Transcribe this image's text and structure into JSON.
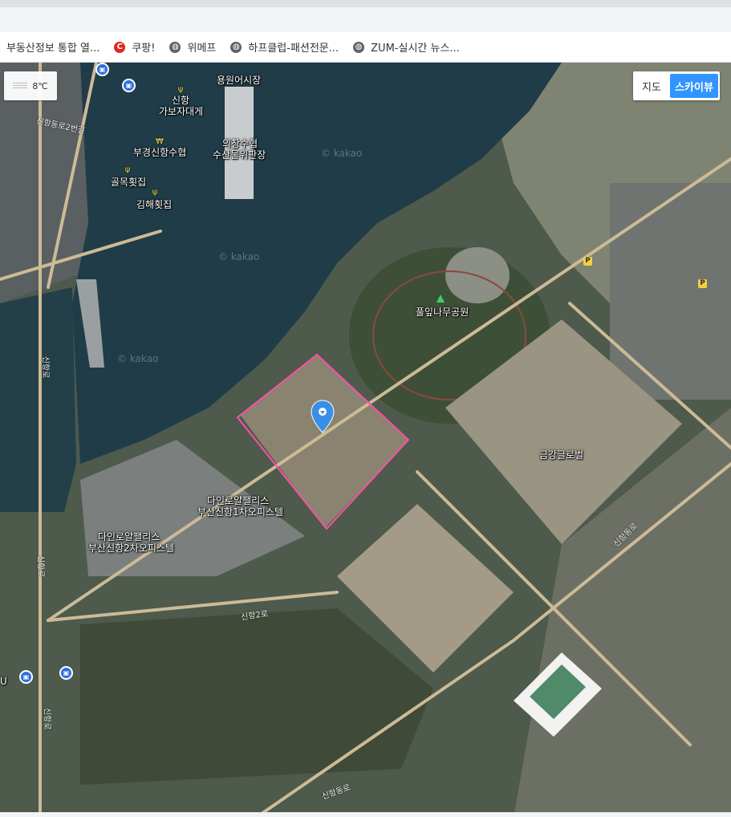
{
  "bookmarks": [
    {
      "label": "부동산정보 통합 열...",
      "icon": "none"
    },
    {
      "label": "쿠팡!",
      "icon": "coupang-icon"
    },
    {
      "label": "위메프",
      "icon": "globe-icon"
    },
    {
      "label": "하프클럽-패션전문...",
      "icon": "globe-icon"
    },
    {
      "label": "ZUM-실시간 뉴스...",
      "icon": "globe-icon"
    }
  ],
  "weather": {
    "temp": "8℃",
    "icon": "cloud-icon"
  },
  "map_type": {
    "map": "지도",
    "skyview": "스카이뷰",
    "active": "skyview",
    "active_color": "#3294ff"
  },
  "map": {
    "place_labels": {
      "fish_market": "용원어시장",
      "shinhang": "신항",
      "gabo": "가보자대게",
      "buggyeong": "부경신항수협",
      "golmok": "골목횟집",
      "gimhae": "김해횟집",
      "uichang_1": "의창수협",
      "uichang_2": "수산물위판장",
      "park": "풀잎나무공원",
      "geumgang": "금강글로벌",
      "daein1_1": "다인로얄팰리스",
      "daein1_2": "부산신항1차오피스텔",
      "daein2_1": "다인로얄팰리스",
      "daein2_2": "부산신항2차오피스텔"
    },
    "road_labels": {
      "r1": "신항2로",
      "r2": "신항로",
      "r3": "신항동로",
      "r4": "신항로",
      "r5": "신항로",
      "r6": "신항동로",
      "r7": "신항동로2번길"
    },
    "watermark": "© kakao",
    "highlight_color": "#ff4fa8",
    "marker_color": "#3a8ee6",
    "parking": "P",
    "bus_label": "U"
  }
}
